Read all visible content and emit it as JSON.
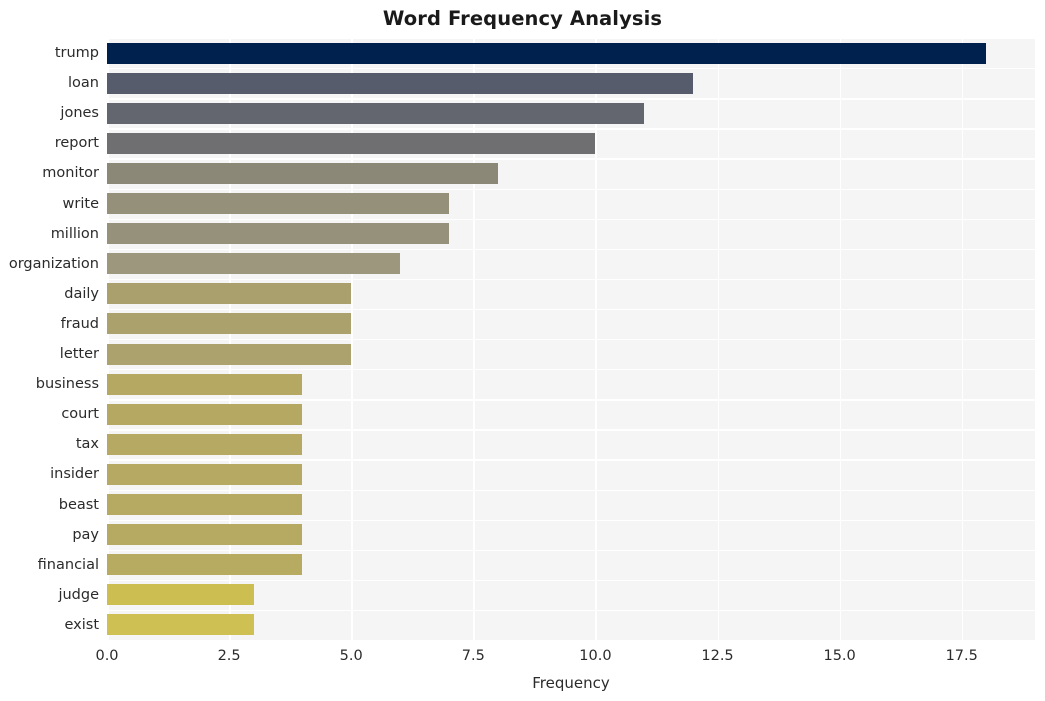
{
  "chart_data": {
    "type": "bar",
    "orientation": "horizontal",
    "title": "Word Frequency Analysis",
    "xlabel": "Frequency",
    "ylabel": "",
    "categories": [
      "trump",
      "loan",
      "jones",
      "report",
      "monitor",
      "write",
      "million",
      "organization",
      "daily",
      "fraud",
      "letter",
      "business",
      "court",
      "tax",
      "insider",
      "beast",
      "pay",
      "financial",
      "judge",
      "exist"
    ],
    "values": [
      18,
      12,
      11,
      10,
      8,
      7,
      7,
      6,
      5,
      5,
      5,
      4,
      4,
      4,
      4,
      4,
      4,
      4,
      3,
      3
    ],
    "bar_colors": [
      "#00204d",
      "#575c6d",
      "#63656f",
      "#6f6f71",
      "#8b8878",
      "#94907a",
      "#95917b",
      "#9d977d",
      "#a9a06d",
      "#aaa16d",
      "#aba26d",
      "#b4a863",
      "#b4a863",
      "#b5a963",
      "#b5a963",
      "#b6aa63",
      "#b6aa63",
      "#b7ab62",
      "#cdbe52",
      "#cec052"
    ],
    "xlim": [
      0,
      19
    ],
    "x_ticks": [
      0.0,
      2.5,
      5.0,
      7.5,
      10.0,
      12.5,
      15.0,
      17.5
    ],
    "x_tick_labels": [
      "0.0",
      "2.5",
      "5.0",
      "7.5",
      "10.0",
      "12.5",
      "15.0",
      "17.5"
    ],
    "grid": true,
    "grid_color": "#ffffff",
    "plot_background": "#f5f5f5",
    "figure_background": "#ffffff",
    "legend": null,
    "colormap": "cividis"
  }
}
